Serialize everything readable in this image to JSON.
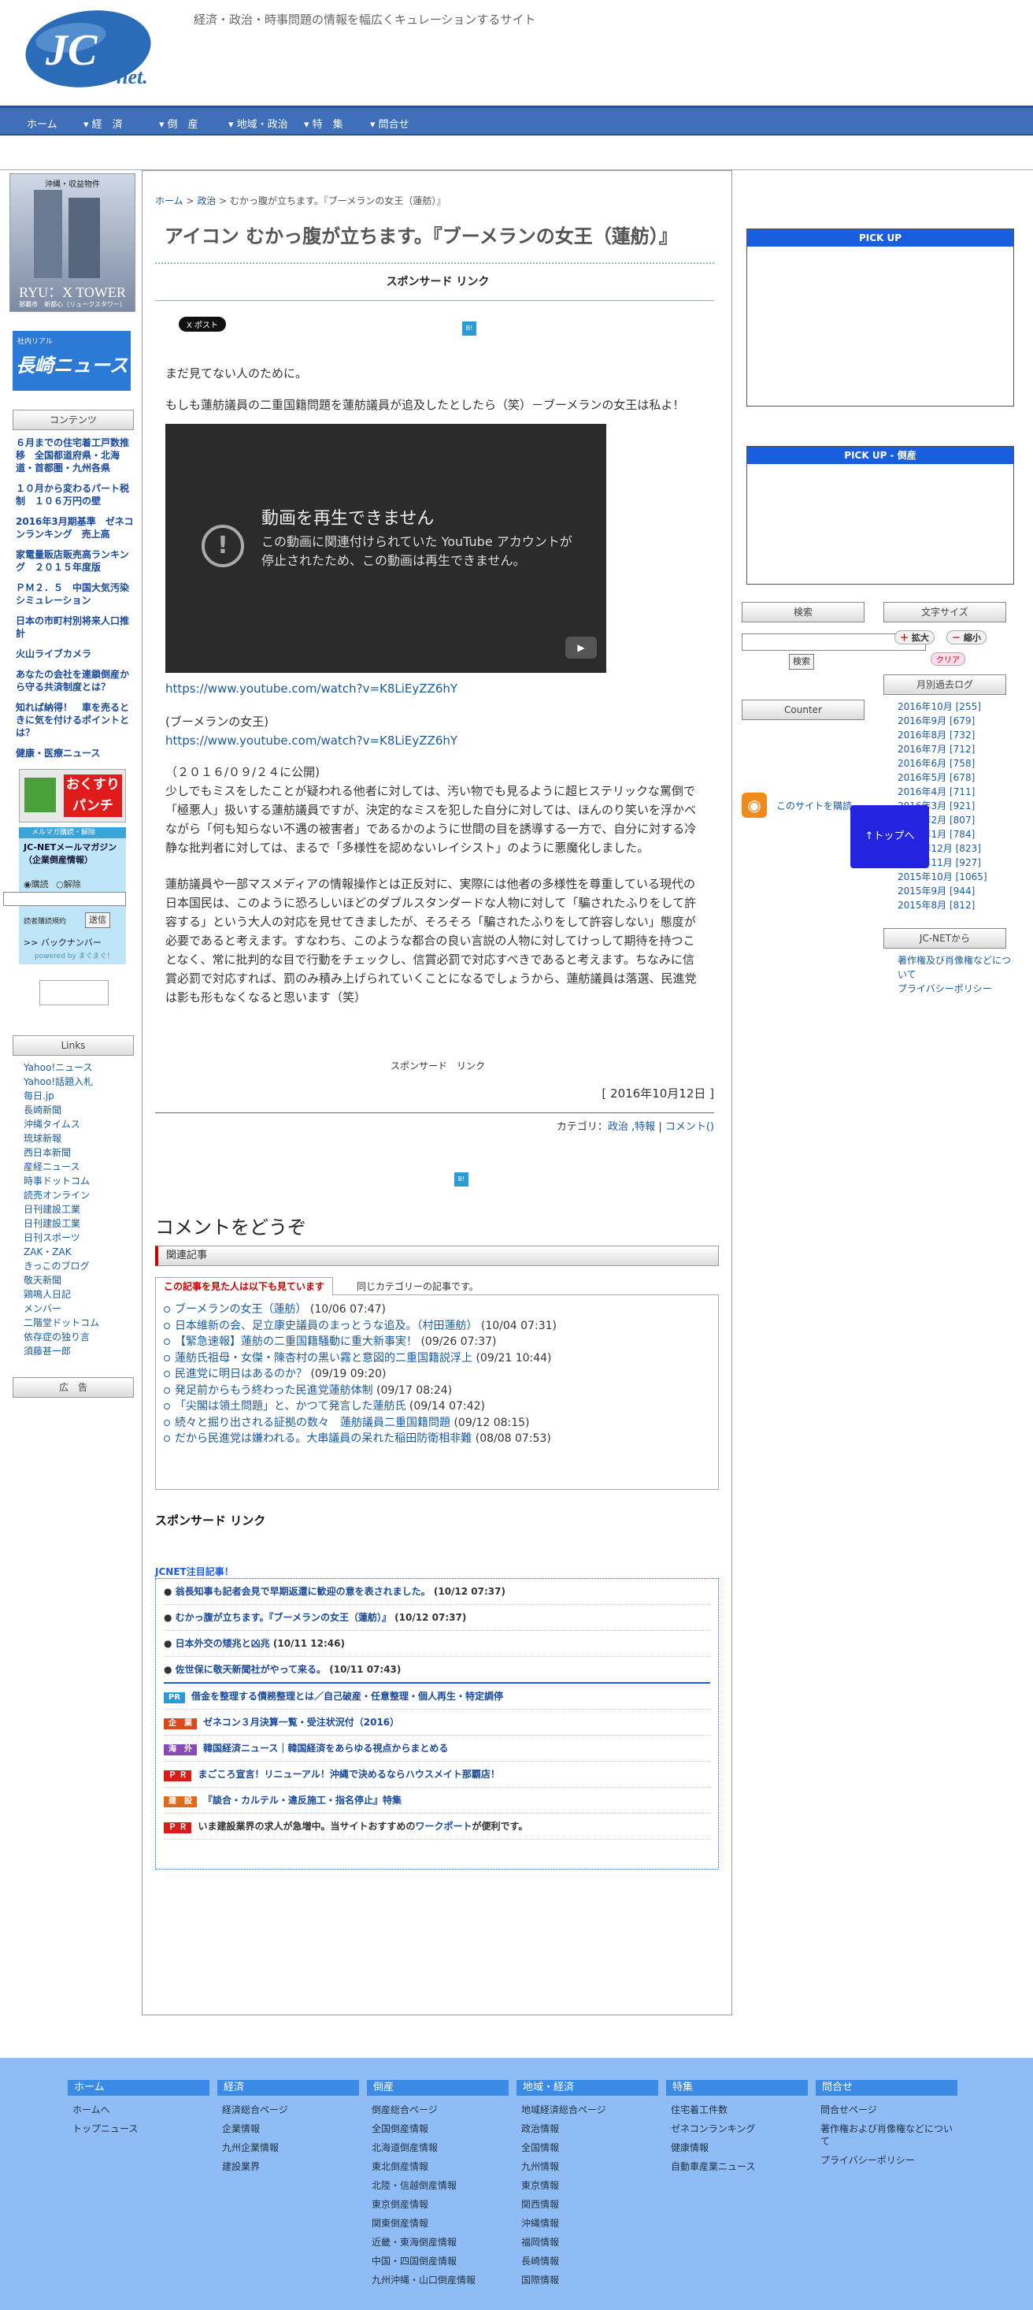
{
  "header": {
    "logo_text": "JC net.",
    "tagline": "経済・政治・時事問題の情報を幅広くキュレーションするサイト"
  },
  "nav": [
    "ホーム",
    "経　済",
    "倒　産",
    "地域・政治",
    "特　集",
    "問合せ"
  ],
  "left": {
    "banner1_title": "沖縄・収益物件",
    "banner1_sub": "RYU：X TOWER",
    "banner1_caption": "那覇市　新都心（リュークスタワー）",
    "banner2_sub": "社内リアル",
    "banner2_title": "長崎ニュース",
    "contents_title": "コンテンツ",
    "contents": [
      "６月までの住宅着工戸数推移　全国都道府県・北海道・首都圏・九州各県",
      "１０月から変わるパート税制　１０６万円の壁",
      "2016年3月期基準　ゼネコンランキング　売上高",
      "家電量販店販売高ランキング　２０１５年度版",
      "ＰＭ２．５　中国大気汚染シミュレーション",
      "日本の市町村別将来人口推計",
      "火山ライブカメラ",
      "あなたの会社を連鎖倒産から守る共済制度とは？",
      "知れば納得！　車を売るときに気を付けるポイントとは？",
      "健康・医療ニュース"
    ],
    "kusuri_banner": "おくすりパンチ",
    "mail": {
      "badge": "メルマガ購読・解除",
      "title": "JC-NETメールマガジン（企業倒産情報）",
      "subscribe": "購読",
      "unsubscribe": "解除",
      "email_label": "読者購読規約",
      "send": "送信",
      "backnumber": ">> バックナンバー",
      "powered": "powered by まぐまぐ！"
    },
    "links_title": "Links",
    "links": [
      "Yahoo!ニュース",
      "Yahoo!話題入札",
      "毎日.jp",
      "長崎新聞",
      "沖縄タイムス",
      "琉球新報",
      "西日本新聞",
      "産経ニュース",
      "時事ドットコム",
      "読売オンライン",
      "日刊建設工業",
      "日刊建設工業",
      "日刊スポーツ",
      "ZAK・ZAK",
      "きっこのブログ",
      "敬天新聞",
      "鶏鳴人日記",
      "メンバー",
      "二階堂ドットコム",
      "依存症の独り言",
      "須藤甚一郎"
    ],
    "ad_title": "広　告"
  },
  "main": {
    "breadcrumb": [
      "ホーム",
      "政治",
      "むかっ腹が立ちます。『ブーメランの女王（蓮舫）』"
    ],
    "title": "アイコン むかっ腹が立ちます。『ブーメランの女王（蓮舫）』",
    "sponsored": "スポンサード リンク",
    "tweet": "X ポスト",
    "intro": "まだ見てない人のために。",
    "para1": "もしも蓮舫議員の二重国籍問題を蓮舫議員が追及したとしたら（笑）－ブーメランの女王は私よ！",
    "video_error_title": "動画を再生できません",
    "video_error_body": "この動画に関連付けられていた YouTube アカウントが停止されたため、この動画は再生できません。",
    "video_url": "https://www.youtube.com/watch?v=K8LiEyZZ6hY",
    "caption": "(ブーメランの女王)",
    "caption_url": "https://www.youtube.com/watch?v=K8LiEyZZ6hY",
    "date_line": "（２０１６/０９/２４に公開)",
    "para2": "少しでもミスをしたことが疑われる他者に対しては、汚い物でも見るように超ヒステリックな罵倒で「極悪人」扱いする蓮舫議員ですが、決定的なミスを犯した自分に対しては、ほんのり笑いを浮かべながら「何も知らない不遇の被害者」であるかのように世間の目を誘導する一方で、自分に対する冷静な批判者に対しては、まるで「多様性を認めないレイシスト」のように悪魔化しました。",
    "para3": "蓮舫議員や一部マスメディアの情報操作とは正反対に、実際には他者の多様性を尊重している現代の日本国民は、このように恐ろしいほどのダブルスタンダードな人物に対して「騙されたふりをして許容する」という大人の対応を見せてきましたが、そろそろ「騙されたふりをして許容しない」態度が必要であると考えます。すなわち、このような都合の良い言説の人物に対してけっして期待を持つことなく、常に批判的な目で行動をチェックし、信賞必罰で対応すべきであると考えます。ちなみに信賞必罰で対応すれば、罰のみ積み上げられていくことになるでしょうから、蓮舫議員は落選、民進党は影も形もなくなると思います（笑）",
    "sponsored2": "スポンサード　リンク",
    "posted_date": "[ 2016年10月12日 ]",
    "category_label": "カテゴリ：",
    "category_links": [
      "政治",
      "特報"
    ],
    "comment_link": "コメント()",
    "comment_heading": "コメントをどうぞ",
    "related_title": "関連記事",
    "tab_active": "この記事を見た人は以下も見ています",
    "tab_other": "同じカテゴリーの記事です。",
    "related": [
      {
        "title": "ブーメランの女王（蓮舫）",
        "date": "(10/06 07:47)"
      },
      {
        "title": "日本維新の会、足立康史議員のまっとうな追及。（村田蓮舫）",
        "date": "(10/04 07:31)"
      },
      {
        "title": "【緊急速報】蓮舫の二重国籍騒動に重大新事実！",
        "date": "(09/26 07:37)"
      },
      {
        "title": "蓮舫氏祖母・女傑・陳杏村の黒い霧と意図的二重国籍説浮上",
        "date": "(09/21 10:44)"
      },
      {
        "title": "民進党に明日はあるのか？",
        "date": "(09/19 09:20)"
      },
      {
        "title": "発足前からもう終わった民進党蓮舫体制",
        "date": "(09/17 08:24)"
      },
      {
        "title": "「尖閣は領土問題」と、かつて発言した蓮舫氏",
        "date": "(09/14 07:42)"
      },
      {
        "title": "続々と掘り出される証拠の数々　蓮舫議員二重国籍問題",
        "date": "(09/12 08:15)"
      },
      {
        "title": "だから民進党は嫌われる。大串議員の呆れた稲田防衛相非難",
        "date": "(08/08 07:53)"
      }
    ],
    "sponsored3": "スポンサード リンク",
    "jcnet_title": "JCNET注目記事！",
    "jcnet_items": [
      {
        "title": "翁長知事も記者会見で早期返還に歓迎の意を表されました。",
        "date": "(10/12 07:37)"
      },
      {
        "title": "むかっ腹が立ちます。『ブーメランの女王（蓮舫）』",
        "date": "(10/12 07:37)"
      },
      {
        "title": "日本外交の矮兆と凶兆",
        "date": "(10/11 12:46)"
      },
      {
        "title": "佐世保に敬天新聞社がやって来る。",
        "date": "(10/11 07:43)"
      }
    ],
    "ad_items": [
      {
        "tag": "PR",
        "color": "#2a9bd6",
        "text": "借金を整理する債務整理とは／自己破産・任意整理・個人再生・特定調停"
      },
      {
        "tag": "企　業",
        "color": "#d84a1b",
        "text": "ゼネコン３月決算一覧・受注状況付（2016）"
      },
      {
        "tag": "海　外",
        "color": "#8a4ab5",
        "text": "韓国経済ニュース｜韓国経済をあらゆる視点からまとめる"
      },
      {
        "tag": "Ｐ Ｒ",
        "color": "#d81b1b",
        "text": "まごころ宣言！リニューアル！沖縄で決めるならハウスメイト那覇店！"
      },
      {
        "tag": "建　設",
        "color": "#e06a1b",
        "text": "『談合・カルテル・違反施工・指名停止』特集"
      },
      {
        "tag": "Ｐ Ｒ",
        "color": "#d81b1b",
        "text_a": "いま建設業界の求人が急増中。当サイトおすすめの",
        "text_link": "ワークポート",
        "text_b": "が便利です。"
      }
    ]
  },
  "right": {
    "pickup": "PICK UP",
    "pickup2": "PICK UP - 倒産",
    "search_btn": "検索",
    "search_submit": "検索",
    "fontsize_btn": "文字サイズ",
    "enlarge": "拡大",
    "shrink": "縮小",
    "clear": "クリア",
    "counter": "Counter",
    "archive_title": "月別過去ログ",
    "archives": [
      "2016年10月 [255]",
      "2016年9月 [679]",
      "2016年8月 [732]",
      "2016年7月 [712]",
      "2016年6月 [758]",
      "2016年5月 [678]",
      "2016年4月 [711]",
      "2016年3月 [921]",
      "2016年2月 [807]",
      "2016年1月 [784]",
      "2015年12月 [823]",
      "2015年11月 [927]",
      "2015年10月 [1065]",
      "2015年9月 [944]",
      "2015年8月 [812]"
    ],
    "rss_text": "このサイトを購読",
    "totop": "↑トップへ",
    "jcnet_from": "JC-NETから",
    "jcnet_links": [
      "著作権及び肖像権などについて",
      "プライバシーポリシー"
    ]
  },
  "footer": {
    "cols": [
      {
        "head": "ホーム",
        "items": [
          "ホームへ",
          "トップニュース"
        ]
      },
      {
        "head": "経済",
        "items": [
          "経済総合ページ",
          "企業情報",
          "九州企業情報",
          "建設業界"
        ]
      },
      {
        "head": "倒産",
        "items": [
          "倒産総合ページ",
          "全国倒産情報",
          "北海道倒産情報",
          "東北倒産情報",
          "北陸・信越倒産情報",
          "東京倒産情報",
          "関東倒産情報",
          "近畿・東海倒産情報",
          "中国・四国倒産情報",
          "九州沖縄・山口倒産情報"
        ]
      },
      {
        "head": "地域・経済",
        "items": [
          "地域経済総合ページ",
          "政治情報",
          "全国情報",
          "九州情報",
          "東京情報",
          "関西情報",
          "沖縄情報",
          "福岡情報",
          "長崎情報",
          "国際情報"
        ]
      },
      {
        "head": "特集",
        "items": [
          "住宅着工件数",
          "ゼネコンランキング",
          "健康情報",
          "自動車産業ニュース"
        ]
      },
      {
        "head": "問合せ",
        "items": [
          "問合せページ",
          "著作権および肖像権などについて",
          "プライバシーポリシー"
        ]
      }
    ]
  },
  "colors": {
    "nav": "#3e6fb8",
    "accent": "#1a5ee0",
    "footer": "#8fbcf4",
    "link": "#1a5a9a"
  }
}
